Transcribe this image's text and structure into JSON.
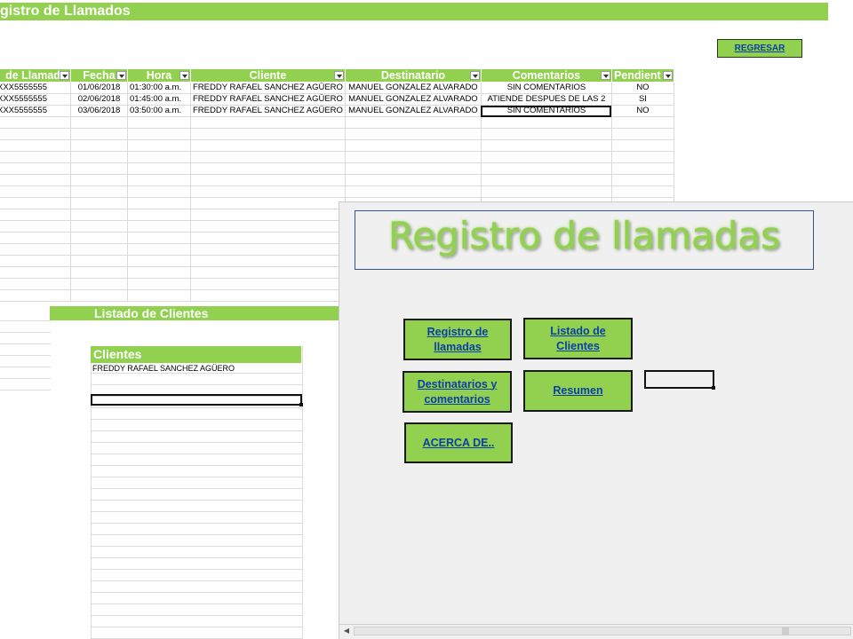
{
  "calls_sheet": {
    "title": "gistro de Llamados",
    "back_button": "REGRESAR",
    "columns": [
      "de Llamad",
      "Fecha",
      "Hora",
      "Cliente",
      "Destinatario",
      "Comentarios",
      "Pendient"
    ],
    "rows": [
      [
        "XXX5555555",
        "01/06/2018",
        "01:30:00 a.m.",
        "FREDDY RAFAEL SANCHEZ AGÜERO",
        "MANUEL GONZALEZ ALVARADO",
        "SIN COMENTARIOS",
        "NO"
      ],
      [
        "XXX5555555",
        "02/06/2018",
        "01:45:00 a.m.",
        "FREDDY RAFAEL SANCHEZ AGÜERO",
        "MANUEL GONZALEZ ALVARADO",
        "ATIENDE DESPUES DE LAS 2",
        "SI"
      ],
      [
        "XXX5555555",
        "03/06/2018",
        "03:50:00 a.m.",
        "FREDDY RAFAEL SANCHEZ AGÜERO",
        "MANUEL GONZALEZ ALVARADO",
        "SIN COMENTARIOS",
        "NO"
      ]
    ],
    "selected_cell": {
      "row": 2,
      "col": 5
    }
  },
  "clients_sheet": {
    "title": "Listado de Clientes",
    "header": "Clientes",
    "rows": [
      "FREDDY RAFAEL SANCHEZ AGÜERO"
    ]
  },
  "menu_form": {
    "title": "Registro de llamadas",
    "buttons": {
      "registro": "Registro de llamadas",
      "listado": "Listado de Clientes",
      "destinatarios": "Destinatarios y comentarios",
      "resumen": "Resumen",
      "acerca": "ACERCA DE.."
    }
  },
  "colors": {
    "accent_green": "#92d050",
    "link_blue": "#0b3fa8",
    "form_background": "#f0f0f0"
  }
}
